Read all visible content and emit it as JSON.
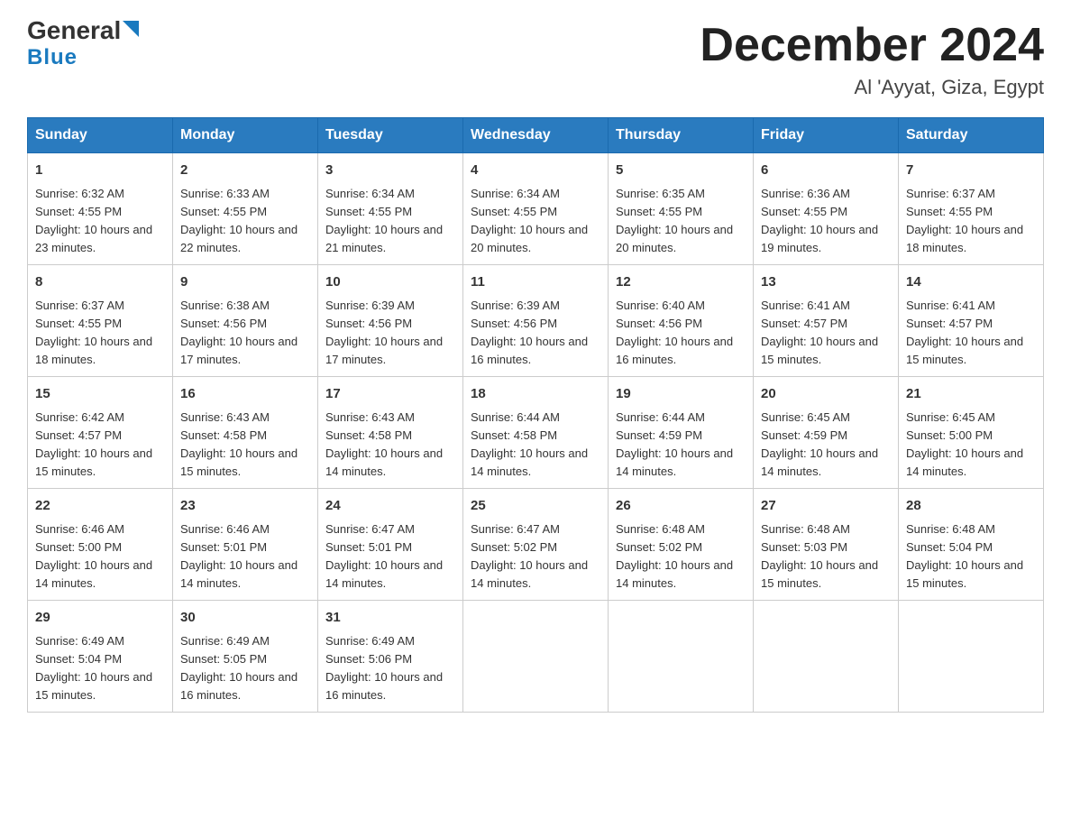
{
  "header": {
    "logo_general": "General",
    "logo_blue": "Blue",
    "month_title": "December 2024",
    "location": "Al 'Ayyat, Giza, Egypt"
  },
  "days_of_week": [
    "Sunday",
    "Monday",
    "Tuesday",
    "Wednesday",
    "Thursday",
    "Friday",
    "Saturday"
  ],
  "weeks": [
    [
      {
        "day": "1",
        "sunrise": "6:32 AM",
        "sunset": "4:55 PM",
        "daylight": "10 hours and 23 minutes."
      },
      {
        "day": "2",
        "sunrise": "6:33 AM",
        "sunset": "4:55 PM",
        "daylight": "10 hours and 22 minutes."
      },
      {
        "day": "3",
        "sunrise": "6:34 AM",
        "sunset": "4:55 PM",
        "daylight": "10 hours and 21 minutes."
      },
      {
        "day": "4",
        "sunrise": "6:34 AM",
        "sunset": "4:55 PM",
        "daylight": "10 hours and 20 minutes."
      },
      {
        "day": "5",
        "sunrise": "6:35 AM",
        "sunset": "4:55 PM",
        "daylight": "10 hours and 20 minutes."
      },
      {
        "day": "6",
        "sunrise": "6:36 AM",
        "sunset": "4:55 PM",
        "daylight": "10 hours and 19 minutes."
      },
      {
        "day": "7",
        "sunrise": "6:37 AM",
        "sunset": "4:55 PM",
        "daylight": "10 hours and 18 minutes."
      }
    ],
    [
      {
        "day": "8",
        "sunrise": "6:37 AM",
        "sunset": "4:55 PM",
        "daylight": "10 hours and 18 minutes."
      },
      {
        "day": "9",
        "sunrise": "6:38 AM",
        "sunset": "4:56 PM",
        "daylight": "10 hours and 17 minutes."
      },
      {
        "day": "10",
        "sunrise": "6:39 AM",
        "sunset": "4:56 PM",
        "daylight": "10 hours and 17 minutes."
      },
      {
        "day": "11",
        "sunrise": "6:39 AM",
        "sunset": "4:56 PM",
        "daylight": "10 hours and 16 minutes."
      },
      {
        "day": "12",
        "sunrise": "6:40 AM",
        "sunset": "4:56 PM",
        "daylight": "10 hours and 16 minutes."
      },
      {
        "day": "13",
        "sunrise": "6:41 AM",
        "sunset": "4:57 PM",
        "daylight": "10 hours and 15 minutes."
      },
      {
        "day": "14",
        "sunrise": "6:41 AM",
        "sunset": "4:57 PM",
        "daylight": "10 hours and 15 minutes."
      }
    ],
    [
      {
        "day": "15",
        "sunrise": "6:42 AM",
        "sunset": "4:57 PM",
        "daylight": "10 hours and 15 minutes."
      },
      {
        "day": "16",
        "sunrise": "6:43 AM",
        "sunset": "4:58 PM",
        "daylight": "10 hours and 15 minutes."
      },
      {
        "day": "17",
        "sunrise": "6:43 AM",
        "sunset": "4:58 PM",
        "daylight": "10 hours and 14 minutes."
      },
      {
        "day": "18",
        "sunrise": "6:44 AM",
        "sunset": "4:58 PM",
        "daylight": "10 hours and 14 minutes."
      },
      {
        "day": "19",
        "sunrise": "6:44 AM",
        "sunset": "4:59 PM",
        "daylight": "10 hours and 14 minutes."
      },
      {
        "day": "20",
        "sunrise": "6:45 AM",
        "sunset": "4:59 PM",
        "daylight": "10 hours and 14 minutes."
      },
      {
        "day": "21",
        "sunrise": "6:45 AM",
        "sunset": "5:00 PM",
        "daylight": "10 hours and 14 minutes."
      }
    ],
    [
      {
        "day": "22",
        "sunrise": "6:46 AM",
        "sunset": "5:00 PM",
        "daylight": "10 hours and 14 minutes."
      },
      {
        "day": "23",
        "sunrise": "6:46 AM",
        "sunset": "5:01 PM",
        "daylight": "10 hours and 14 minutes."
      },
      {
        "day": "24",
        "sunrise": "6:47 AM",
        "sunset": "5:01 PM",
        "daylight": "10 hours and 14 minutes."
      },
      {
        "day": "25",
        "sunrise": "6:47 AM",
        "sunset": "5:02 PM",
        "daylight": "10 hours and 14 minutes."
      },
      {
        "day": "26",
        "sunrise": "6:48 AM",
        "sunset": "5:02 PM",
        "daylight": "10 hours and 14 minutes."
      },
      {
        "day": "27",
        "sunrise": "6:48 AM",
        "sunset": "5:03 PM",
        "daylight": "10 hours and 15 minutes."
      },
      {
        "day": "28",
        "sunrise": "6:48 AM",
        "sunset": "5:04 PM",
        "daylight": "10 hours and 15 minutes."
      }
    ],
    [
      {
        "day": "29",
        "sunrise": "6:49 AM",
        "sunset": "5:04 PM",
        "daylight": "10 hours and 15 minutes."
      },
      {
        "day": "30",
        "sunrise": "6:49 AM",
        "sunset": "5:05 PM",
        "daylight": "10 hours and 16 minutes."
      },
      {
        "day": "31",
        "sunrise": "6:49 AM",
        "sunset": "5:06 PM",
        "daylight": "10 hours and 16 minutes."
      },
      {
        "day": "",
        "sunrise": "",
        "sunset": "",
        "daylight": ""
      },
      {
        "day": "",
        "sunrise": "",
        "sunset": "",
        "daylight": ""
      },
      {
        "day": "",
        "sunrise": "",
        "sunset": "",
        "daylight": ""
      },
      {
        "day": "",
        "sunrise": "",
        "sunset": "",
        "daylight": ""
      }
    ]
  ],
  "labels": {
    "sunrise_prefix": "Sunrise: ",
    "sunset_prefix": "Sunset: ",
    "daylight_prefix": "Daylight: "
  }
}
